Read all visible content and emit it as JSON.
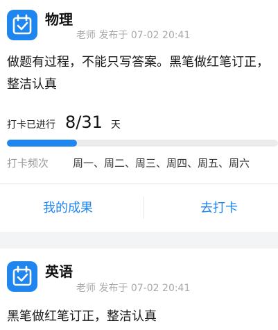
{
  "cards": [
    {
      "subject": "物理",
      "meta_prefix": "老师",
      "meta": "老师 发布于 07-02 20:41",
      "content": "做题有过程，不能只写答案。黑笔做红笔订正，整洁认真",
      "progress_label": "打卡已进行",
      "progress_count": "8/31",
      "progress_unit": "天",
      "progress_fraction": 0.258,
      "frequency_label": "打卡频次",
      "frequency_days": "周一、周二、周三、周四、周五、周六",
      "actions": {
        "left": "我的成果",
        "right": "去打卡"
      }
    },
    {
      "subject": "英语",
      "meta": "老师 发布于 07-02 20:41",
      "content": "黑笔做红笔订正，整洁认真"
    }
  ],
  "colors": {
    "accent": "#1f86f0",
    "background": "#f3f4f6"
  },
  "icons": {
    "app": "calendar-check-icon"
  }
}
